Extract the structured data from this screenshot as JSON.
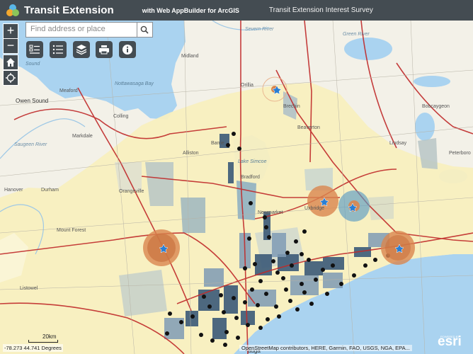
{
  "header": {
    "title": "Transit Extension",
    "subtitle": "with Web AppBuilder for ArcGIS",
    "survey_link": "Transit Extension Interest Survey"
  },
  "search": {
    "placeholder": "Find address or place"
  },
  "zoom": {
    "in_label": "+",
    "out_label": "−"
  },
  "toolbar": [
    "legend",
    "layer list",
    "basemap",
    "print",
    "about"
  ],
  "map_labels": {
    "owen_sound": "Owen Sound",
    "meaford": "Meaford",
    "collingwood": "Colling",
    "markdale": "Markdale",
    "hanover": "Hanover",
    "durham": "Durham",
    "mount_forest": "Mount Forest",
    "listowel": "Listowel",
    "midland": "Midland",
    "barrie": "Barrie",
    "orillia": "Orillia",
    "brechin": "Brechin",
    "beaverton": "Beaverton",
    "bobcaygeon": "Bobcaygeon",
    "peterborough": "Peterboro",
    "lindsay": "Lindsay",
    "alliston": "Alliston",
    "orangeville": "Orangeville",
    "bradford": "Bradford",
    "newmarket": "Newmarket",
    "uxbridge": "Uxbridge",
    "mississauga": "auga",
    "gravenhurst_river": "Severn River",
    "saugeen_river": "Saugeen River",
    "nottawasaga_bay": "Nottawasaga Bay",
    "sound": "Sound",
    "lake_simcoe": "Lake Simcoe",
    "green_river": "Green River"
  },
  "coordinates": "-78.273 44.741 Degrees",
  "scale": "20km",
  "attribution": "OpenStreetMap contributors, HERE, Garmin, FAO, USGS, NGA, EPA...",
  "esri": {
    "powered_by": "POWERED BY",
    "logo": "esri"
  },
  "colors": {
    "header_bg": "#444c52",
    "land": "#f4f1e6",
    "study_area": "#f7efbe",
    "water": "#a9d3f0",
    "roads": "#c02a2a",
    "survey_circle": "#d9864f",
    "survey_circle_alt": "#5b9bc4",
    "station_dot": "#111111",
    "marker_pin": "#2a7fd4"
  }
}
